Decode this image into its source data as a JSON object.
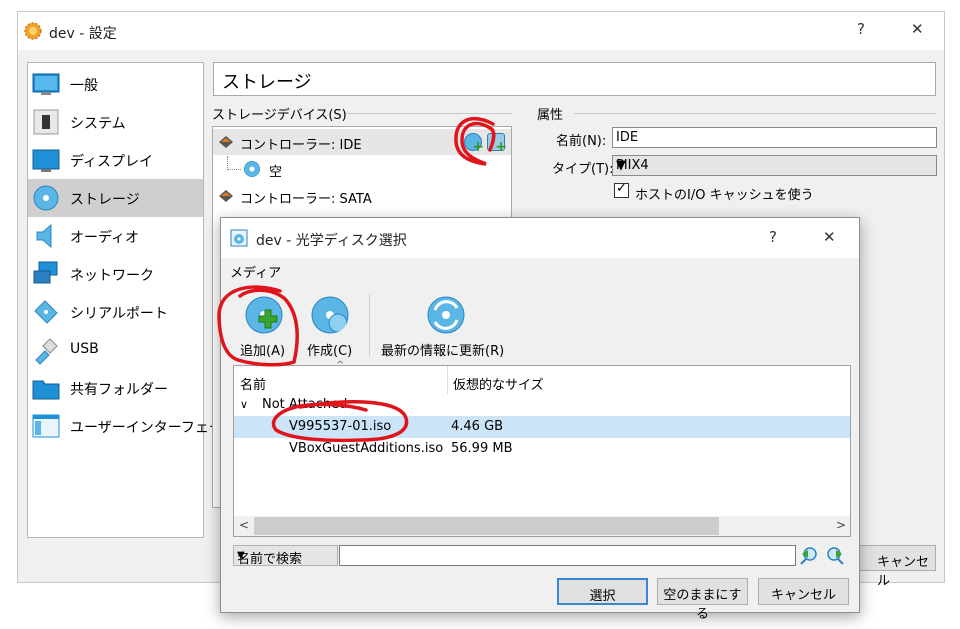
{
  "outer_window": {
    "title": "dev - 設定",
    "help": "?",
    "close": "✕",
    "section_title": "ストレージ",
    "sidebar": [
      {
        "label": "一般",
        "icon": "general-icon"
      },
      {
        "label": "システム",
        "icon": "system-icon"
      },
      {
        "label": "ディスプレイ",
        "icon": "display-icon"
      },
      {
        "label": "ストレージ",
        "icon": "storage-icon",
        "selected": true
      },
      {
        "label": "オーディオ",
        "icon": "audio-icon"
      },
      {
        "label": "ネットワーク",
        "icon": "network-icon"
      },
      {
        "label": "シリアルポート",
        "icon": "serial-port-icon"
      },
      {
        "label": "USB",
        "icon": "usb-icon"
      },
      {
        "label": "共有フォルダー",
        "icon": "shared-folder-icon"
      },
      {
        "label": "ユーザーインターフェース",
        "icon": "user-interface-icon"
      }
    ],
    "storage_devices_label": "ストレージデバイス(S)",
    "tree": {
      "controller_ide": "コントローラー: IDE",
      "empty": "空",
      "controller_sata": "コントローラー: SATA"
    },
    "attributes_label": "属性",
    "attributes": {
      "name_label": "名前(N):",
      "name_value": "IDE",
      "type_label": "タイプ(T):",
      "type_value": "PIIX4",
      "host_cache_label": "ホストのI/O キャッシュを使う",
      "host_cache_checked": true
    },
    "cancel_label": "キャンセル"
  },
  "dialog": {
    "title": "dev - 光学ディスク選択",
    "help": "?",
    "close": "✕",
    "media_label": "メディア",
    "toolbar": {
      "add": "追加(A)",
      "create": "作成(C)",
      "refresh": "最新の情報に更新(R)"
    },
    "columns": {
      "name": "名前",
      "virtual_size": "仮想的なサイズ"
    },
    "group": "Not Attached",
    "rows": [
      {
        "name": "V995537-01.iso",
        "size": "4.46 GB",
        "selected": true
      },
      {
        "name": "VBoxGuestAdditions.iso",
        "size": "56.99 MB",
        "selected": false
      }
    ],
    "search_mode": "名前で検索",
    "search_value": "",
    "buttons": {
      "select": "選択",
      "leave_empty": "空のままにする",
      "cancel": "キャンセル"
    }
  },
  "colors": {
    "selection_blue": "#cce4f7",
    "annotation_red": "#e0141c",
    "disc_blue": "#5bb6e6",
    "plus_green": "#3aa52e"
  }
}
